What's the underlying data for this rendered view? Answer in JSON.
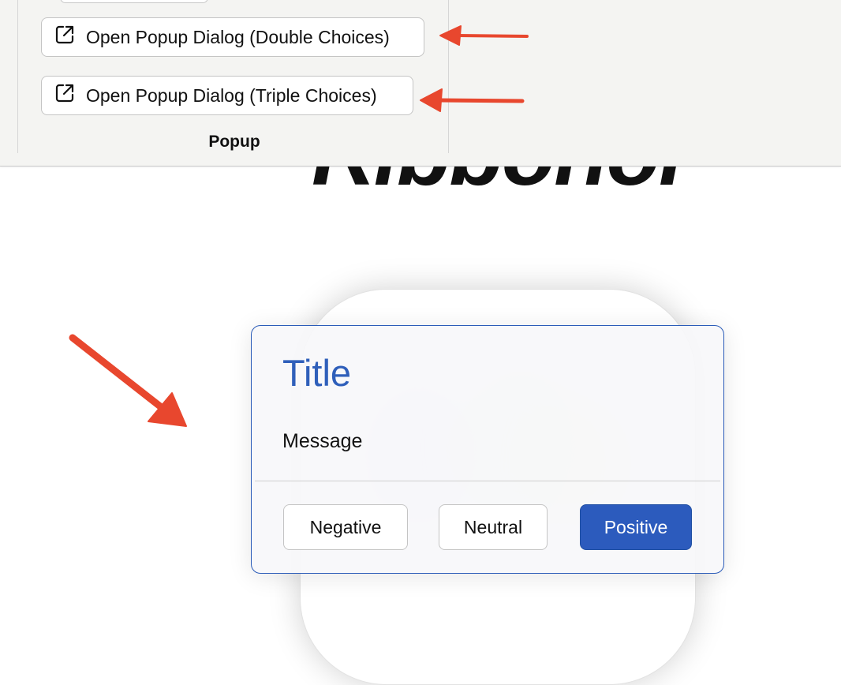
{
  "background": {
    "heading_fragment": "Ribbonor"
  },
  "ribbon": {
    "buttons": [
      {
        "label": "Open Popup Dialog (Double Choices)",
        "icon": "open-external-icon"
      },
      {
        "label": "Open Popup Dialog (Triple Choices)",
        "icon": "open-external-icon"
      }
    ],
    "group_label": "Popup"
  },
  "annotations": {
    "arrow_color": "#e8472e"
  },
  "dialog": {
    "title": "Title",
    "message": "Message",
    "buttons": {
      "negative": "Negative",
      "neutral": "Neutral",
      "positive": "Positive"
    },
    "accent_color": "#2f5fba",
    "positive_button_color": "#2c5bbd"
  }
}
